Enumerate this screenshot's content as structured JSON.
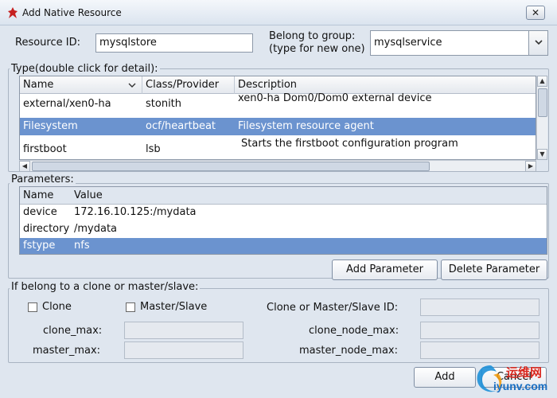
{
  "window": {
    "title": "Add Native Resource",
    "close_glyph": "✕"
  },
  "resource": {
    "id_label": "Resource ID:",
    "id_value": "mysqlstore",
    "group_label_line1": "Belong to group:",
    "group_label_line2": "(type for new one)",
    "group_value": "mysqlservice"
  },
  "type_section": {
    "legend": "Type(double click for detail):",
    "columns": [
      "Name",
      "Class/Provider",
      "Description"
    ],
    "rows": [
      {
        "name": "external/xen0-ha",
        "provider": "stonith",
        "description": "xen0-ha Dom0/Dom0 external device"
      },
      {
        "name": "Filesystem",
        "provider": "ocf/heartbeat",
        "description": "Filesystem resource agent"
      },
      {
        "name": "firstboot",
        "provider": "lsb",
        "description": "Starts the firstboot configuration program"
      }
    ],
    "selected_index": 1
  },
  "params_section": {
    "legend": "Parameters:",
    "columns": [
      "Name",
      "Value"
    ],
    "rows": [
      {
        "name": "device",
        "value": "172.16.10.125:/mydata"
      },
      {
        "name": "directory",
        "value": "/mydata"
      },
      {
        "name": "fstype",
        "value": "nfs"
      }
    ],
    "selected_index": 2,
    "add_label": "Add Parameter",
    "delete_label": "Delete Parameter"
  },
  "clone_section": {
    "legend": "If belong to a clone or master/slave:",
    "clone_label": "Clone",
    "master_slave_label": "Master/Slave",
    "id_label": "Clone or Master/Slave ID:",
    "clone_max_label": "clone_max:",
    "master_max_label": "master_max:",
    "clone_node_max_label": "clone_node_max:",
    "master_node_max_label": "master_node_max:"
  },
  "footer": {
    "add_label": "Add",
    "cancel_label": "Cancel"
  },
  "watermark": {
    "line1": "运维网",
    "line2": "iyunv.com"
  },
  "colors": {
    "selection": "#6b93cf",
    "window_bg": "#dfe6ef"
  }
}
